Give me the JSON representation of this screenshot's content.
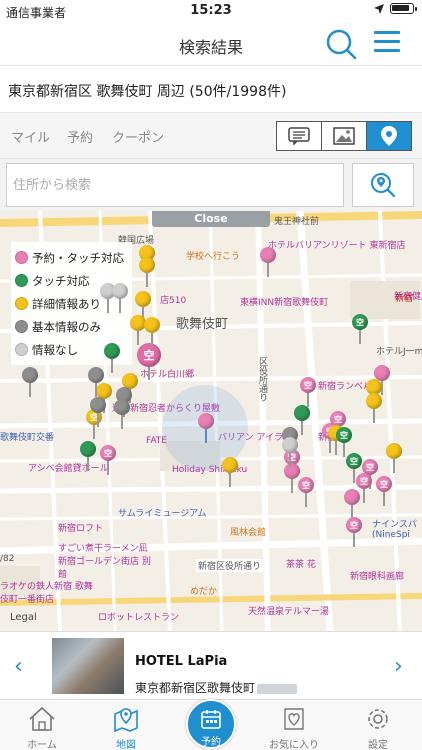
{
  "status_bar": {
    "carrier": "通信事業者",
    "time": "15:23"
  },
  "nav": {
    "title": "検索結果"
  },
  "location": {
    "text": "東京都新宿区 歌舞伎町 周辺 (50件/1998件)"
  },
  "filters": {
    "tabs": [
      "マイル",
      "予約",
      "クーポン"
    ]
  },
  "search": {
    "placeholder": "住所から検索"
  },
  "map": {
    "close_label": "Close",
    "legal": "Legal",
    "district": "歌舞伎町",
    "labels": [
      "鬼王神社前",
      "韓国広場",
      "学校へ行こう",
      "ホテルバリアンリゾート 東新宿店",
      "新宿健康",
      "東横INN新宿歌舞伎町",
      "ホテルJ一mex",
      "ホテル白川郷",
      "新宿ランベルホ",
      "区役所通り",
      "道場新宿忍者からくり屋敷",
      "バリアン アイラ",
      "新宿店",
      "歌舞伎町交番",
      "FATE",
      "アシベ会館貸ホール",
      "Holiday Shinjuku",
      "サムライミュージアム",
      "風林会館",
      "新宿ロフト",
      "ナインスパ (NineSpi",
      "すごい煮干ラーメン凪 新宿ゴールデン街店 別館",
      "新宿区役所通り",
      "茶茶 花",
      "新宿眼科画廊",
      "ラオケの鉄人新宿 歌舞伎町一番街店",
      "めだか",
      "天然温泉テルマー湯",
      "ロボットレストラン",
      "新宿",
      "店510",
      "/82"
    ]
  },
  "legend": [
    {
      "label": "予約・タッチ対応",
      "color": "#e87fb5"
    },
    {
      "label": "タッチ対応",
      "color": "#2f9a55"
    },
    {
      "label": "詳細情報あり",
      "color": "#f4c21a"
    },
    {
      "label": "基本情報のみ",
      "color": "#8e8e8e"
    },
    {
      "label": "情報なし",
      "color": "#cfcfcf"
    }
  ],
  "pin_badge": "空",
  "card": {
    "name": "HOTEL LaPia",
    "address": "東京都新宿区歌舞伎町"
  },
  "tab_bar": {
    "home": "ホーム",
    "map": "地図",
    "reserve": "予約",
    "favorites": "お気に入り",
    "settings": "設定"
  },
  "colors": {
    "accent": "#1f8fd0"
  }
}
